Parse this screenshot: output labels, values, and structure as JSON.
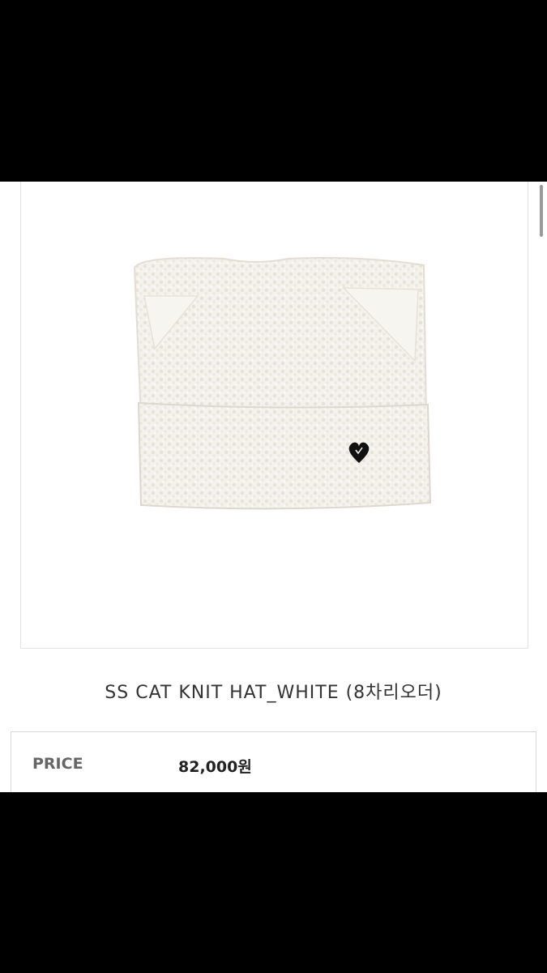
{
  "product": {
    "image_alt": "cat-ear knit hat",
    "title": "SS CAT KNIT HAT_WHITE (8차리오더)",
    "price_label": "PRICE",
    "price_value": "82,000원"
  },
  "colors": {
    "hat": "#f4f2ec",
    "hat_shadow": "#e4e1d9",
    "heart_patch": "#111111"
  },
  "icons": {
    "heart_patch": "heart-icon"
  }
}
